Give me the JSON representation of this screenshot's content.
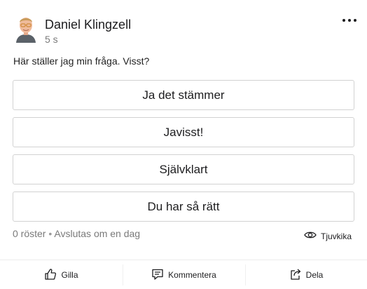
{
  "post": {
    "author": "Daniel Klingzell",
    "time": "5 s",
    "question": "Här ställer jag min fråga. Visst?"
  },
  "poll": {
    "options": [
      {
        "label": "Ja det stämmer"
      },
      {
        "label": "Javisst!"
      },
      {
        "label": "Självklart"
      },
      {
        "label": "Du har så rätt"
      }
    ],
    "votes": "0 röster",
    "separator": "•",
    "ends": "Avslutas om en dag",
    "anonymous_label": "Tjuvkika"
  },
  "actions": {
    "like": "Gilla",
    "comment": "Kommentera",
    "share": "Dela"
  },
  "icons": {
    "more": "more-horizontal-icon",
    "eye": "eye-icon",
    "like": "thumbs-up-icon",
    "comment": "comment-icon",
    "share": "share-icon"
  }
}
